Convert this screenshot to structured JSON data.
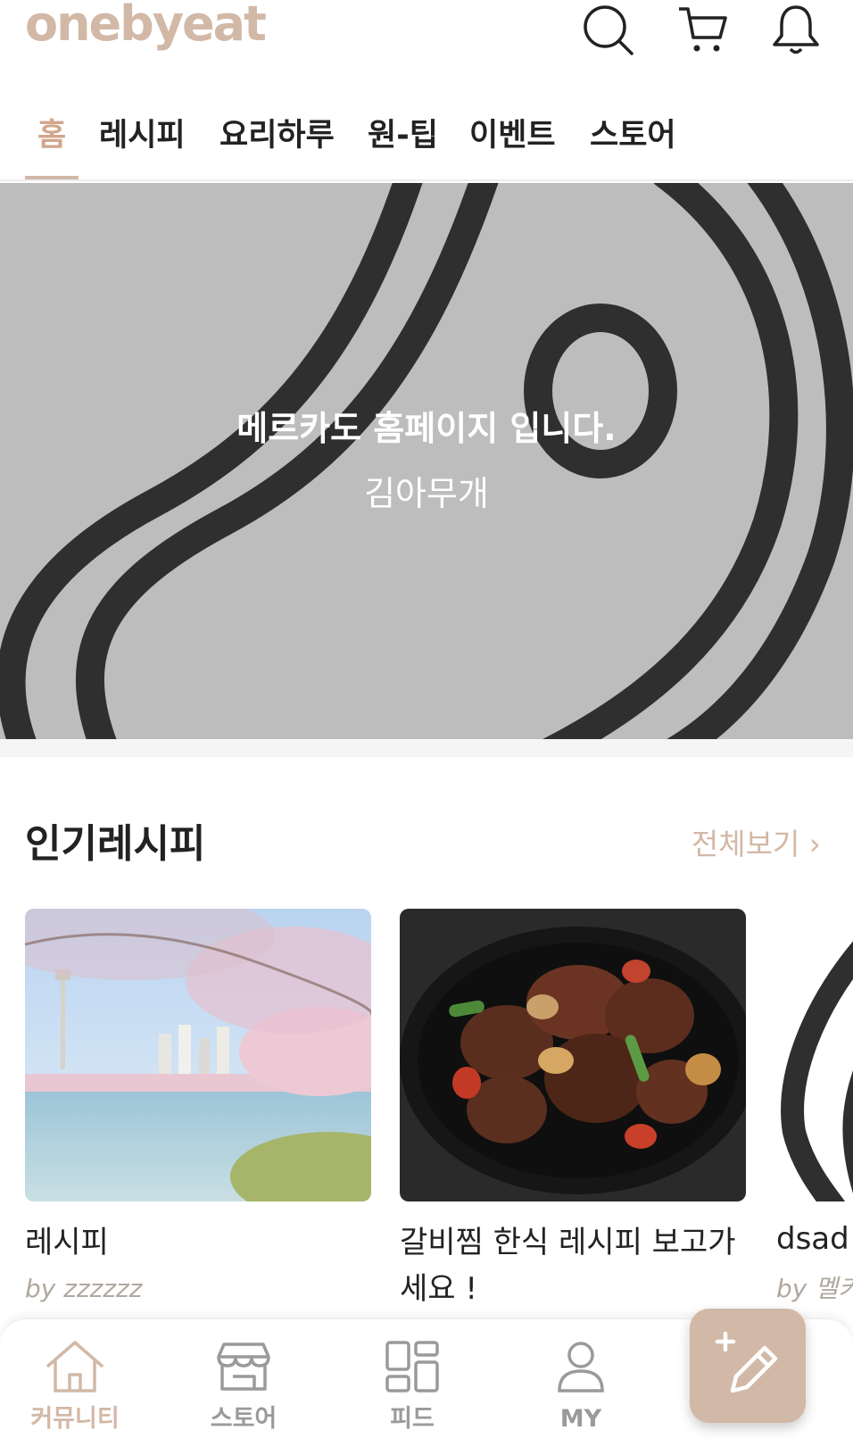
{
  "app": {
    "logo_text": "onebyeat",
    "brand_color": "#d2b8a6"
  },
  "header": {
    "icons": [
      "search-icon",
      "cart-icon",
      "bell-icon"
    ]
  },
  "tabs": [
    {
      "label": "홈",
      "active": true
    },
    {
      "label": "레시피"
    },
    {
      "label": "요리하루"
    },
    {
      "label": "원-팁"
    },
    {
      "label": "이벤트"
    },
    {
      "label": "스토어"
    }
  ],
  "banner": {
    "title": "메르카도 홈페이지 입니다.",
    "subtitle": "김아무개"
  },
  "popular": {
    "title": "인기레시피",
    "see_all": "전체보기 ›",
    "cards": [
      {
        "title": "레시피",
        "author_prefix": "by",
        "author": "zzzzzz"
      },
      {
        "title": "갈비찜 한식 레시피 보고가세요 !",
        "author_prefix": "by",
        "author": ""
      },
      {
        "title": "dsad",
        "author_prefix": "by",
        "author": "멜키"
      }
    ]
  },
  "bottom_nav": [
    {
      "label": "커뮤니티",
      "icon": "home-icon",
      "active": true
    },
    {
      "label": "스토어",
      "icon": "store-icon"
    },
    {
      "label": "피드",
      "icon": "feed-icon"
    },
    {
      "label": "MY",
      "icon": "user-icon"
    }
  ],
  "fab": {
    "icon": "write-icon"
  }
}
